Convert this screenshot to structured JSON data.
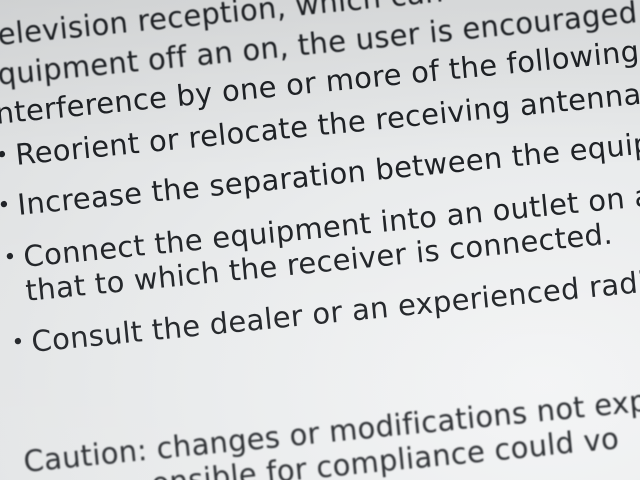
{
  "lines": [
    {
      "text": "elevision reception, which can"
    },
    {
      "text": "quipment off an on, the user is encouraged t"
    },
    {
      "text": "nterference by one or more of the following m"
    },
    {
      "bullet": "•",
      "text": "Reorient or relocate the receiving antenna."
    },
    {
      "bullet": "•",
      "text": "Increase the separation between the equip"
    },
    {
      "bullet": "•",
      "text": "Connect the equipment into an outlet on a"
    },
    {
      "text": "that to which the receiver is connected."
    },
    {
      "bullet": "•",
      "text": "Consult the dealer or an experienced radio"
    },
    {
      "text": "Caution: changes or modifications not exp"
    },
    {
      "text": "onsible for compliance could vo"
    }
  ]
}
